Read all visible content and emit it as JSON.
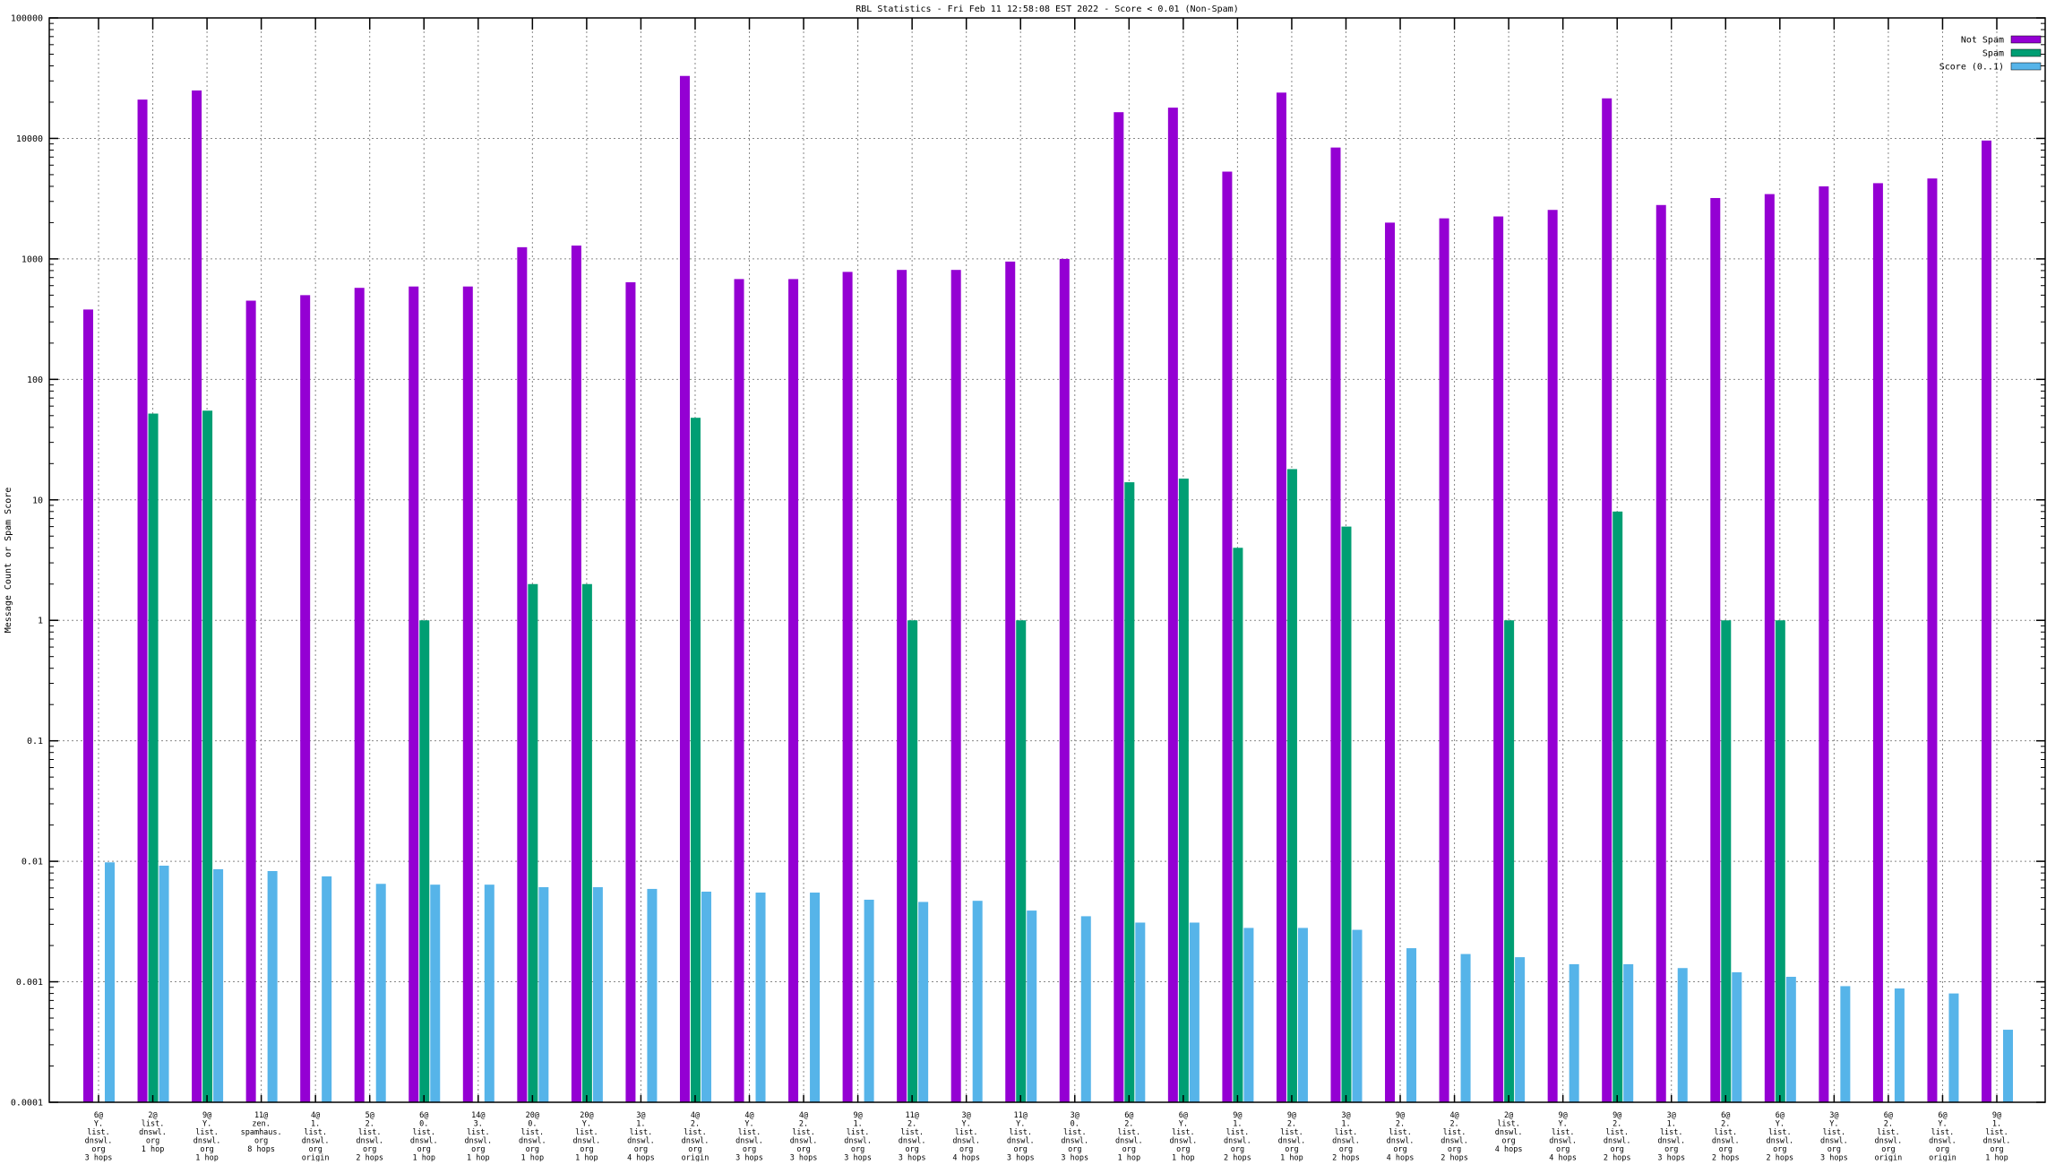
{
  "title": "RBL Statistics - Fri Feb 11 12:58:08 EST 2022 - Score < 0.01 (Non-Spam)",
  "ylabel": "Message Count or Spam Score",
  "legend": [
    {
      "label": "Not Spam",
      "color": "#9400d3"
    },
    {
      "label": "Spam",
      "color": "#009e73"
    },
    {
      "label": "Score (0..1)",
      "color": "#56b4e9"
    }
  ],
  "colors": {
    "not_spam": "#9400d3",
    "spam": "#009e73",
    "score": "#56b4e9",
    "grid": "#888888",
    "axis": "#000000",
    "background": "#ffffff"
  },
  "chart_data": {
    "type": "bar",
    "y_scale": "log",
    "ylim": [
      0.0001,
      100000
    ],
    "grid": true,
    "legend_position": "top-right",
    "yticks": [
      {
        "label": "100000",
        "value": 100000
      },
      {
        "label": "10000",
        "value": 10000
      },
      {
        "label": "1000",
        "value": 1000
      },
      {
        "label": "100",
        "value": 100
      },
      {
        "label": "10",
        "value": 10
      },
      {
        "label": "1",
        "value": 1
      },
      {
        "label": "0.1",
        "value": 0.1
      },
      {
        "label": "0.01",
        "value": 0.01
      },
      {
        "label": "0.001",
        "value": 0.001
      },
      {
        "label": "0.0001",
        "value": 0.0001
      }
    ],
    "categories": [
      {
        "lines": [
          "6@",
          "Y.",
          "list.",
          "dnswl.",
          "org",
          "3 hops"
        ]
      },
      {
        "lines": [
          "2@",
          "list.",
          "dnswl.",
          "org",
          "1 hop"
        ]
      },
      {
        "lines": [
          "9@",
          "Y.",
          "list.",
          "dnswl.",
          "org",
          "1 hop"
        ]
      },
      {
        "lines": [
          "11@",
          "zen.",
          "spamhaus.",
          "org",
          "8 hops"
        ]
      },
      {
        "lines": [
          "4@",
          "1.",
          "list.",
          "dnswl.",
          "org",
          "origin"
        ]
      },
      {
        "lines": [
          "5@",
          "2.",
          "list.",
          "dnswl.",
          "org",
          "2 hops"
        ]
      },
      {
        "lines": [
          "6@",
          "0.",
          "list.",
          "dnswl.",
          "org",
          "1 hop"
        ]
      },
      {
        "lines": [
          "14@",
          "3.",
          "list.",
          "dnswl.",
          "org",
          "1 hop"
        ]
      },
      {
        "lines": [
          "20@",
          "0.",
          "list.",
          "dnswl.",
          "org",
          "1 hop"
        ]
      },
      {
        "lines": [
          "20@",
          "Y.",
          "list.",
          "dnswl.",
          "org",
          "1 hop"
        ]
      },
      {
        "lines": [
          "3@",
          "1.",
          "list.",
          "dnswl.",
          "org",
          "4 hops"
        ]
      },
      {
        "lines": [
          "4@",
          "2.",
          "list.",
          "dnswl.",
          "org",
          "origin"
        ]
      },
      {
        "lines": [
          "4@",
          "Y.",
          "list.",
          "dnswl.",
          "org",
          "3 hops"
        ]
      },
      {
        "lines": [
          "4@",
          "2.",
          "list.",
          "dnswl.",
          "org",
          "3 hops"
        ]
      },
      {
        "lines": [
          "9@",
          "1.",
          "list.",
          "dnswl.",
          "org",
          "3 hops"
        ]
      },
      {
        "lines": [
          "11@",
          "2.",
          "list.",
          "dnswl.",
          "org",
          "3 hops"
        ]
      },
      {
        "lines": [
          "3@",
          "Y.",
          "list.",
          "dnswl.",
          "org",
          "4 hops"
        ]
      },
      {
        "lines": [
          "11@",
          "Y.",
          "list.",
          "dnswl.",
          "org",
          "3 hops"
        ]
      },
      {
        "lines": [
          "3@",
          "0.",
          "list.",
          "dnswl.",
          "org",
          "3 hops"
        ]
      },
      {
        "lines": [
          "6@",
          "2.",
          "list.",
          "dnswl.",
          "org",
          "1 hop"
        ]
      },
      {
        "lines": [
          "6@",
          "Y.",
          "list.",
          "dnswl.",
          "org",
          "1 hop"
        ]
      },
      {
        "lines": [
          "9@",
          "1.",
          "list.",
          "dnswl.",
          "org",
          "2 hops"
        ]
      },
      {
        "lines": [
          "9@",
          "2.",
          "list.",
          "dnswl.",
          "org",
          "1 hop"
        ]
      },
      {
        "lines": [
          "3@",
          "1.",
          "list.",
          "dnswl.",
          "org",
          "2 hops"
        ]
      },
      {
        "lines": [
          "9@",
          "2.",
          "list.",
          "dnswl.",
          "org",
          "4 hops"
        ]
      },
      {
        "lines": [
          "4@",
          "2.",
          "list.",
          "dnswl.",
          "org",
          "2 hops"
        ]
      },
      {
        "lines": [
          "2@",
          "list.",
          "dnswl.",
          "org",
          "4 hops"
        ]
      },
      {
        "lines": [
          "9@",
          "Y.",
          "list.",
          "dnswl.",
          "org",
          "4 hops"
        ]
      },
      {
        "lines": [
          "9@",
          "2.",
          "list.",
          "dnswl.",
          "org",
          "2 hops"
        ]
      },
      {
        "lines": [
          "3@",
          "1.",
          "list.",
          "dnswl.",
          "org",
          "3 hops"
        ]
      },
      {
        "lines": [
          "6@",
          "2.",
          "list.",
          "dnswl.",
          "org",
          "2 hops"
        ]
      },
      {
        "lines": [
          "6@",
          "Y.",
          "list.",
          "dnswl.",
          "org",
          "2 hops"
        ]
      },
      {
        "lines": [
          "3@",
          "Y.",
          "list.",
          "dnswl.",
          "org",
          "3 hops"
        ]
      },
      {
        "lines": [
          "6@",
          "2.",
          "list.",
          "dnswl.",
          "org",
          "origin"
        ]
      },
      {
        "lines": [
          "6@",
          "Y.",
          "list.",
          "dnswl.",
          "org",
          "origin"
        ]
      },
      {
        "lines": [
          "9@",
          "1.",
          "list.",
          "dnswl.",
          "org",
          "1 hop"
        ]
      }
    ],
    "series": [
      {
        "name": "Not Spam",
        "color": "#9400d3",
        "values": [
          380,
          21000,
          25000,
          450,
          500,
          575,
          590,
          590,
          1250,
          1290,
          640,
          33000,
          680,
          680,
          780,
          810,
          810,
          950,
          1000,
          16500,
          18000,
          5300,
          24000,
          8400,
          2000,
          2170,
          2250,
          2550,
          21500,
          2800,
          3200,
          3450,
          4000,
          4250,
          4650,
          9600
        ]
      },
      {
        "name": "Spam",
        "color": "#009e73",
        "values": [
          null,
          52,
          55,
          null,
          null,
          null,
          1,
          null,
          2,
          2,
          null,
          48,
          null,
          null,
          null,
          1,
          null,
          1,
          null,
          14,
          15,
          4,
          18,
          6,
          null,
          null,
          1,
          null,
          8,
          null,
          1,
          1,
          null,
          null,
          null,
          null
        ]
      },
      {
        "name": "Score (0..1)",
        "color": "#56b4e9",
        "values": [
          0.0098,
          0.0092,
          0.0086,
          0.0083,
          0.0075,
          0.0065,
          0.0064,
          0.0064,
          0.0061,
          0.0061,
          0.0059,
          0.0056,
          0.0055,
          0.0055,
          0.0048,
          0.0046,
          0.0047,
          0.0039,
          0.0035,
          0.0031,
          0.0031,
          0.0028,
          0.0028,
          0.0027,
          0.0019,
          0.0017,
          0.0016,
          0.0014,
          0.0014,
          0.0013,
          0.0012,
          0.0011,
          0.00092,
          0.00088,
          0.0008,
          0.0004
        ]
      }
    ]
  }
}
